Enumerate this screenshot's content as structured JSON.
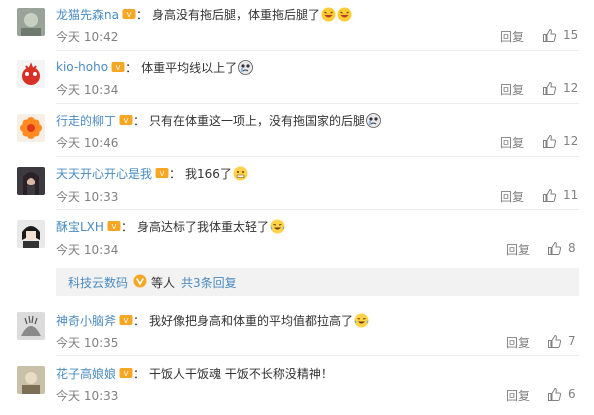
{
  "comments": [
    {
      "user": "龙猫先森na",
      "text": "身高没有拖后腿，体重拖后腿了",
      "emoji": "laugh-cry-emoji",
      "emoji_count": 2,
      "time": "今天 10:42",
      "reply_label": "回复",
      "likes": "15"
    },
    {
      "user": "kio-hoho",
      "text": "体重平均线以上了",
      "emoji": "crying-emoji",
      "emoji_count": 1,
      "time": "今天 10:34",
      "reply_label": "回复",
      "likes": "12"
    },
    {
      "user": "行走的柳丁",
      "text": "只有在体重这一项上，没有拖国家的后腿",
      "emoji": "crying-emoji",
      "emoji_count": 1,
      "time": "今天 10:46",
      "reply_label": "回复",
      "likes": "12"
    },
    {
      "user": "天天开心开心是我",
      "text": "我166了",
      "emoji": "grimace-emoji",
      "emoji_count": 1,
      "time": "今天 10:33",
      "reply_label": "回复",
      "likes": "11"
    },
    {
      "user": "酥宝LXH",
      "text": "身高达标了我体重太轻了",
      "emoji": "laugh-tears-emoji",
      "emoji_count": 1,
      "time": "今天 10:34",
      "reply_label": "回复",
      "likes": "8"
    },
    {
      "user": "神奇小脑斧",
      "text": "我好像把身高和体重的平均值都拉高了",
      "emoji": "laugh-tears-emoji",
      "emoji_count": 1,
      "time": "今天 10:35",
      "reply_label": "回复",
      "likes": "7"
    },
    {
      "user": "花子高娘娘",
      "text": "干饭人干饭魂 干饭不长称没精神！",
      "emoji": "",
      "emoji_count": 0,
      "time": "今天 10:33",
      "reply_label": "回复",
      "likes": "6"
    }
  ],
  "sub_replies": {
    "user": "科技云数码",
    "middle": "等人",
    "link": "共3条回复"
  },
  "colors": {
    "username": "#4a8bc2",
    "meta": "#808080",
    "text": "#333333",
    "subbar_bg": "#f2f2f2",
    "vip_badge": "#f5a623"
  }
}
